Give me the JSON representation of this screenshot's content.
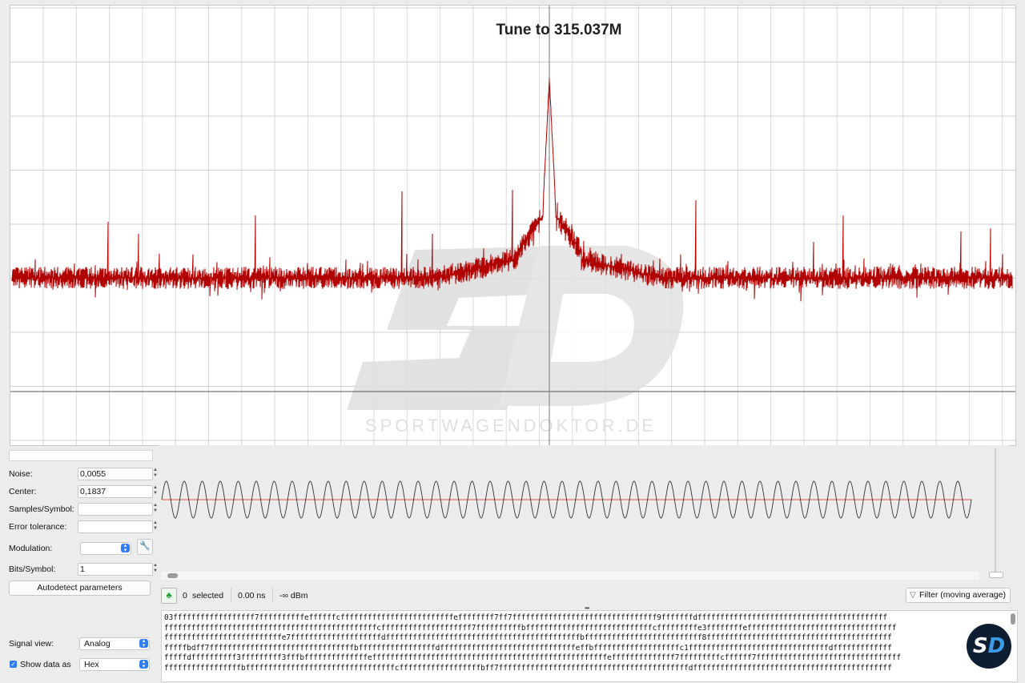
{
  "spectrum": {
    "tune_label": "Tune to 315.037M",
    "trace_color": "#b00000",
    "watermark": "SPORTWAGENDOKTOR.DE"
  },
  "params": {
    "noise_label": "Noise:",
    "noise_value": "0,0055",
    "center_label": "Center:",
    "center_value": "0,1837",
    "samples_label": "Samples/Symbol:",
    "samples_value": "",
    "error_label": "Error tolerance:",
    "error_value": "",
    "modulation_label": "Modulation:",
    "modulation_value": "",
    "bits_label": "Bits/Symbol:",
    "bits_value": "1",
    "autodetect_label": "Autodetect parameters",
    "signal_view_label": "Signal view:",
    "signal_view_value": "Analog",
    "show_data_label": "Show data as",
    "show_data_value": "Hex"
  },
  "toolbar": {
    "selected_count": "0",
    "selected_label": "selected",
    "duration": "0.00 ns",
    "power": "-∞ dBm",
    "filter_label": "Filter (moving average)"
  },
  "hex": {
    "lines": [
      "03ffffffffffffffffff7ffffffffffeffffffcfffffffffffffffffffffffffeffffffff7ff7ffffffffffffffffffffffffffffffff9fffffffdffffffffffffffffffffffffffffffffffffffffff",
      "fffffffffffffffffffffffffffffffffffffffffffffffcffffffffffffffffffff7ffffffffffbffffffffffffffffffffffffffffcfffffffffe3ffffffffefffffffffffffffffffffffffffffffff",
      "ffffffffffffffffffffffffffe7ffffffffffffffffffffdfffffffffffffffffffffffffffffffffffffffffffbffffffffffffffffffffffffff8fffffffffffffffffffffffffffffffffffffffff",
      "fffffbdff7ffffffffffffffffffffffffffffffffbfffffffffffffffffdffffffffffffffffffffffffffffffeffbfffffffffffffffffffc1fffffffffffffffffffffffffffffffdfffffffffffff",
      "fffffdffffffffff3fffffffff3fffbffffffffffffffeffffffffffffffffffffffffffffffffffffffffffffffffffffeffffffffffffff7fffffffffcffffff7ffffffffffffffffffffffffffffffff",
      "fffffffffffffffffbfffffffffffffffffffffffffffffffffcffffffffffffffffffbff7ffffffffffffffffffffffffffffffffffffffffffdffffffffffffffffffffffffffffffffffffffffffff"
    ]
  }
}
